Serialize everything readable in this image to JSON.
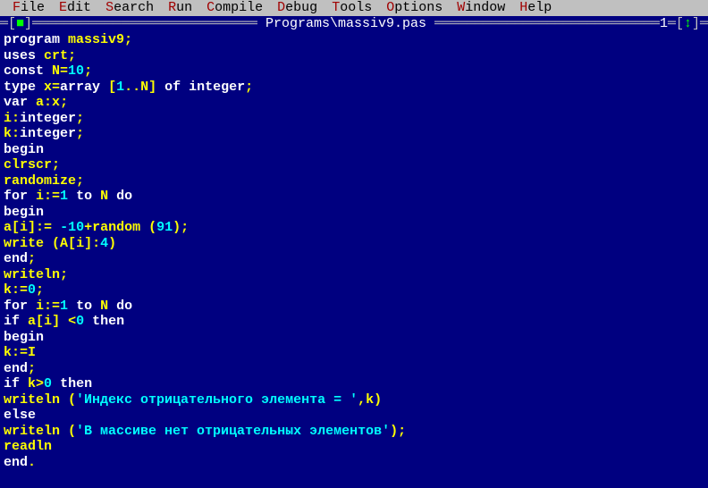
{
  "menu": [
    {
      "hot": "F",
      "rest": "ile"
    },
    {
      "hot": "E",
      "rest": "dit"
    },
    {
      "hot": "S",
      "rest": "earch"
    },
    {
      "hot": "R",
      "rest": "un"
    },
    {
      "hot": "C",
      "rest": "ompile"
    },
    {
      "hot": "D",
      "rest": "ebug"
    },
    {
      "hot": "T",
      "rest": "ools"
    },
    {
      "hot": "O",
      "rest": "ptions"
    },
    {
      "hot": "W",
      "rest": "indow"
    },
    {
      "hot": "H",
      "rest": "elp"
    }
  ],
  "window": {
    "close_glyph": "■",
    "title": " Programs\\massiv9.pas ",
    "number": "1",
    "zoom_glyph": "↕",
    "rule": "══════════════════════════════════════════════════════════════════════════════════"
  },
  "code": [
    [
      [
        "kw",
        "program "
      ],
      [
        "id",
        "massiv9"
      ],
      [
        "sym",
        ";"
      ]
    ],
    [
      [
        "kw",
        "uses "
      ],
      [
        "id",
        "crt"
      ],
      [
        "sym",
        ";"
      ]
    ],
    [
      [
        "kw",
        "const "
      ],
      [
        "id",
        "N"
      ],
      [
        "sym",
        "="
      ],
      [
        "num",
        "10"
      ],
      [
        "sym",
        ";"
      ]
    ],
    [
      [
        "kw",
        "type "
      ],
      [
        "id",
        "x"
      ],
      [
        "sym",
        "="
      ],
      [
        "kw",
        "array "
      ],
      [
        "sym",
        "["
      ],
      [
        "num",
        "1"
      ],
      [
        "sym",
        ".."
      ],
      [
        "id",
        "N"
      ],
      [
        "sym",
        "]"
      ],
      [
        "kw",
        " of integer"
      ],
      [
        "sym",
        ";"
      ]
    ],
    [
      [
        "kw",
        "var "
      ],
      [
        "id",
        "a"
      ],
      [
        "sym",
        ":"
      ],
      [
        "id",
        "x"
      ],
      [
        "sym",
        ";"
      ]
    ],
    [
      [
        "id",
        "i"
      ],
      [
        "sym",
        ":"
      ],
      [
        "kw",
        "integer"
      ],
      [
        "sym",
        ";"
      ]
    ],
    [
      [
        "id",
        "k"
      ],
      [
        "sym",
        ":"
      ],
      [
        "kw",
        "integer"
      ],
      [
        "sym",
        ";"
      ]
    ],
    [
      [
        "kw",
        "begin"
      ]
    ],
    [
      [
        "id",
        "clrscr"
      ],
      [
        "sym",
        ";"
      ]
    ],
    [
      [
        "id",
        "randomize"
      ],
      [
        "sym",
        ";"
      ]
    ],
    [
      [
        "kw",
        "for "
      ],
      [
        "id",
        "i"
      ],
      [
        "sym",
        ":="
      ],
      [
        "num",
        "1"
      ],
      [
        "kw",
        " to "
      ],
      [
        "id",
        "N"
      ],
      [
        "kw",
        " do"
      ]
    ],
    [
      [
        "kw",
        "begin"
      ]
    ],
    [
      [
        "id",
        "a"
      ],
      [
        "sym",
        "["
      ],
      [
        "id",
        "i"
      ],
      [
        "sym",
        "]:= "
      ],
      [
        "num",
        "-10"
      ],
      [
        "sym",
        "+"
      ],
      [
        "id",
        "random "
      ],
      [
        "sym",
        "("
      ],
      [
        "num",
        "91"
      ],
      [
        "sym",
        ");"
      ]
    ],
    [
      [
        "id",
        "write "
      ],
      [
        "sym",
        "("
      ],
      [
        "id",
        "A"
      ],
      [
        "sym",
        "["
      ],
      [
        "id",
        "i"
      ],
      [
        "sym",
        "]:"
      ],
      [
        "num",
        "4"
      ],
      [
        "sym",
        ")"
      ]
    ],
    [
      [
        "kw",
        "end"
      ],
      [
        "sym",
        ";"
      ]
    ],
    [
      [
        "id",
        "writeln"
      ],
      [
        "sym",
        ";"
      ]
    ],
    [
      [
        "id",
        "k"
      ],
      [
        "sym",
        ":="
      ],
      [
        "num",
        "0"
      ],
      [
        "sym",
        ";"
      ]
    ],
    [
      [
        "kw",
        "for "
      ],
      [
        "id",
        "i"
      ],
      [
        "sym",
        ":="
      ],
      [
        "num",
        "1"
      ],
      [
        "kw",
        " to "
      ],
      [
        "id",
        "N"
      ],
      [
        "kw",
        " do"
      ]
    ],
    [
      [
        "kw",
        "if "
      ],
      [
        "id",
        "a"
      ],
      [
        "sym",
        "["
      ],
      [
        "id",
        "i"
      ],
      [
        "sym",
        "] <"
      ],
      [
        "num",
        "0"
      ],
      [
        "kw",
        " then"
      ]
    ],
    [
      [
        "kw",
        "begin"
      ]
    ],
    [
      [
        "id",
        "k"
      ],
      [
        "sym",
        ":="
      ],
      [
        "id",
        "I"
      ]
    ],
    [
      [
        "kw",
        "end"
      ],
      [
        "sym",
        ";"
      ]
    ],
    [
      [
        "kw",
        "if "
      ],
      [
        "id",
        "k"
      ],
      [
        "sym",
        ">"
      ],
      [
        "num",
        "0"
      ],
      [
        "kw",
        " then"
      ]
    ],
    [
      [
        "id",
        "writeln "
      ],
      [
        "sym",
        "("
      ],
      [
        "str",
        "'Индекс отрицательного элемента = '"
      ],
      [
        "sym",
        ","
      ],
      [
        "id",
        "k"
      ],
      [
        "sym",
        ")"
      ]
    ],
    [
      [
        "kw",
        "else"
      ]
    ],
    [
      [
        "id",
        "writeln "
      ],
      [
        "sym",
        "("
      ],
      [
        "str",
        "'В массиве нет отрицательных элементов'"
      ],
      [
        "sym",
        ");"
      ]
    ],
    [
      [
        "id",
        "readln"
      ]
    ],
    [
      [
        "kw",
        "end"
      ],
      [
        "sym",
        "."
      ]
    ]
  ]
}
